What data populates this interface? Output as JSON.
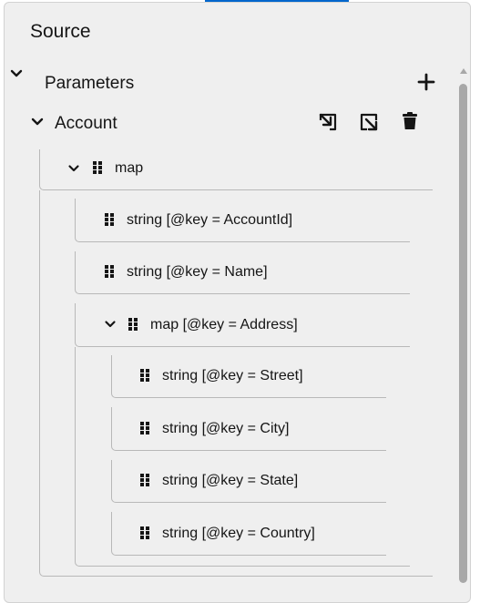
{
  "panel": {
    "title": "Source",
    "accent_color": "#0066cc"
  },
  "parameters": {
    "label": "Parameters",
    "toggle_icon": "chevron-down-icon",
    "add_icon": "plus-icon"
  },
  "account": {
    "label": "Account",
    "actions": [
      {
        "name": "import-icon"
      },
      {
        "name": "export-icon"
      },
      {
        "name": "trash-icon"
      }
    ]
  },
  "tree": {
    "root": {
      "label": "map"
    },
    "items": [
      {
        "label": "string [@key = AccountId]"
      },
      {
        "label": "string [@key = Name]"
      },
      {
        "label": "map [@key = Address]"
      },
      {
        "label": "string [@key = Street]"
      },
      {
        "label": "string [@key = City]"
      },
      {
        "label": "string [@key = State]"
      },
      {
        "label": "string [@key = Country]"
      }
    ]
  }
}
